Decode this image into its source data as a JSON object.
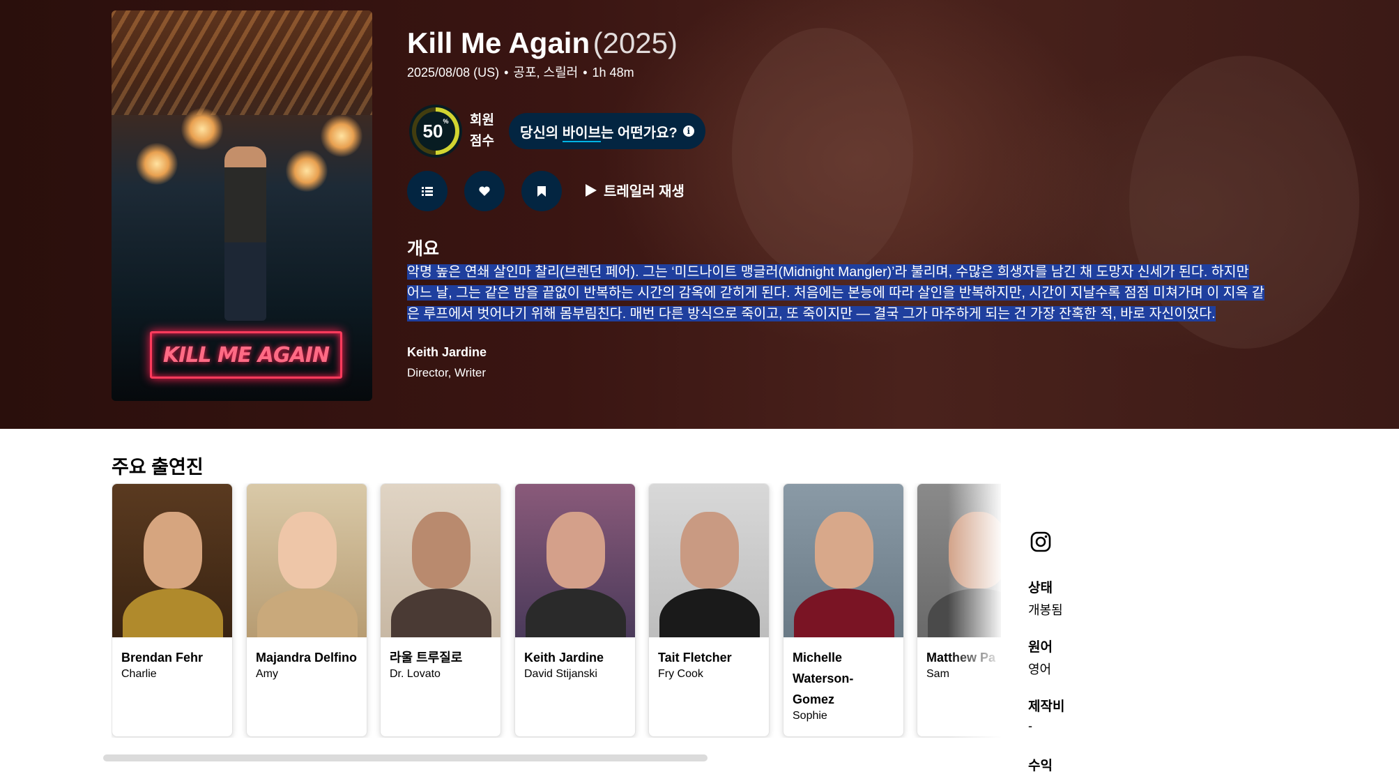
{
  "movie": {
    "title": "Kill Me Again",
    "year": "(2025)",
    "release": "2025/08/08 (US)",
    "genres": "공포, 스릴러",
    "runtime": "1h 48m",
    "poster_text": "KILL ME AGAIN"
  },
  "score": {
    "value": "50",
    "percent_sign": "%",
    "label": "회원 점수",
    "fraction": 0.5,
    "colors": {
      "track": "#423d0f",
      "bar": "#d2d531",
      "bg": "#081c22"
    }
  },
  "vibe": {
    "prefix": "당신의",
    "highlight": "바이브",
    "suffix": "는 어떤가요?"
  },
  "actions": {
    "list_icon": "list-icon",
    "favorite_icon": "heart-icon",
    "watchlist_icon": "bookmark-icon",
    "trailer_icon": "play-icon",
    "trailer_label": "트레일러 재생"
  },
  "overview": {
    "heading": "개요",
    "text": "악명 높은 연쇄 살인마 찰리(브렌던 페어). 그는 ‘미드나이트 맹글러(Midnight Mangler)’라 불리며, 수많은 희생자를 남긴 채 도망자 신세가 된다. 하지만 어느 날, 그는 같은 밤을 끝없이 반복하는 시간의 감옥에 갇히게 된다. 처음에는 본능에 따라 살인을 반복하지만, 시간이 지날수록 점점 미쳐가며 이 지옥 같은 루프에서 벗어나기 위해 몸부림친다. 매번 다른 방식으로 죽이고, 또 죽이지만 — 결국 그가 마주하게 되는 건 가장 잔혹한 적, 바로 자신이었다."
  },
  "crew": [
    {
      "name": "Keith Jardine",
      "job": "Director, Writer"
    }
  ],
  "cast": {
    "heading": "주요 출연진",
    "members": [
      {
        "name": "Brendan Fehr",
        "role": "Charlie"
      },
      {
        "name": "Majandra Delfino",
        "role": "Amy"
      },
      {
        "name": "라울 트루질로",
        "role": "Dr. Lovato"
      },
      {
        "name": "Keith Jardine",
        "role": "David Stijanski"
      },
      {
        "name": "Tait Fletcher",
        "role": "Fry Cook"
      },
      {
        "name": "Michelle Waterson-Gomez",
        "role": "Sophie"
      },
      {
        "name": "Matthew Pa",
        "role": "Sam"
      }
    ]
  },
  "sidebar": {
    "social_icon": "instagram-icon",
    "facts": [
      {
        "label": "상태",
        "value": "개봉됨"
      },
      {
        "label": "원어",
        "value": "영어"
      },
      {
        "label": "제작비",
        "value": "-"
      },
      {
        "label": "수익",
        "value": ""
      }
    ]
  }
}
